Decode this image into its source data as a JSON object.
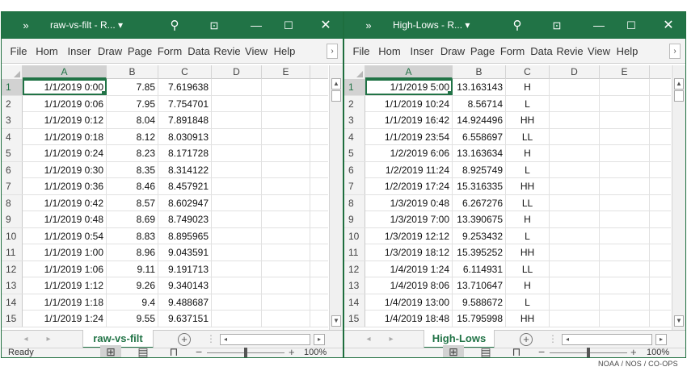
{
  "colors": {
    "excel_green": "#217346",
    "ribbon_bg": "#f3f3f3",
    "selected_header": "#d2d2d2"
  },
  "left": {
    "quick_access": "»",
    "title": "raw-vs-filt - R...",
    "title_arrow": "▾",
    "ribbon_tabs": [
      "File",
      "Hom",
      "Inser",
      "Draw",
      "Page",
      "Form",
      "Data",
      "Revie",
      "View",
      "Help"
    ],
    "columns": [
      "A",
      "B",
      "C",
      "D",
      "E"
    ],
    "rows": [
      {
        "n": "1",
        "a": "1/1/2019 0:00",
        "b": "7.85",
        "c": "7.619638"
      },
      {
        "n": "2",
        "a": "1/1/2019 0:06",
        "b": "7.95",
        "c": "7.754701"
      },
      {
        "n": "3",
        "a": "1/1/2019 0:12",
        "b": "8.04",
        "c": "7.891848"
      },
      {
        "n": "4",
        "a": "1/1/2019 0:18",
        "b": "8.12",
        "c": "8.030913"
      },
      {
        "n": "5",
        "a": "1/1/2019 0:24",
        "b": "8.23",
        "c": "8.171728"
      },
      {
        "n": "6",
        "a": "1/1/2019 0:30",
        "b": "8.35",
        "c": "8.314122"
      },
      {
        "n": "7",
        "a": "1/1/2019 0:36",
        "b": "8.46",
        "c": "8.457921"
      },
      {
        "n": "8",
        "a": "1/1/2019 0:42",
        "b": "8.57",
        "c": "8.602947"
      },
      {
        "n": "9",
        "a": "1/1/2019 0:48",
        "b": "8.69",
        "c": "8.749023"
      },
      {
        "n": "10",
        "a": "1/1/2019 0:54",
        "b": "8.83",
        "c": "8.895965"
      },
      {
        "n": "11",
        "a": "1/1/2019 1:00",
        "b": "8.96",
        "c": "9.043591"
      },
      {
        "n": "12",
        "a": "1/1/2019 1:06",
        "b": "9.11",
        "c": "9.191713"
      },
      {
        "n": "13",
        "a": "1/1/2019 1:12",
        "b": "9.26",
        "c": "9.340143"
      },
      {
        "n": "14",
        "a": "1/1/2019 1:18",
        "b": "9.4",
        "c": "9.488687"
      },
      {
        "n": "15",
        "a": "1/1/2019 1:24",
        "b": "9.55",
        "c": "9.637151"
      }
    ],
    "sheet_tab": "raw-vs-filt",
    "status": "Ready",
    "zoom": "100%"
  },
  "right": {
    "quick_access": "»",
    "title": "High-Lows - R...",
    "title_arrow": "▾",
    "ribbon_tabs": [
      "File",
      "Hom",
      "Inser",
      "Draw",
      "Page",
      "Form",
      "Data",
      "Revie",
      "View",
      "Help"
    ],
    "columns": [
      "A",
      "B",
      "C",
      "D",
      "E"
    ],
    "rows": [
      {
        "n": "1",
        "a": "1/1/2019 5:00",
        "b": "13.163143",
        "c": "H"
      },
      {
        "n": "2",
        "a": "1/1/2019 10:24",
        "b": "8.56714",
        "c": "L"
      },
      {
        "n": "3",
        "a": "1/1/2019 16:42",
        "b": "14.924496",
        "c": "HH"
      },
      {
        "n": "4",
        "a": "1/1/2019 23:54",
        "b": "6.558697",
        "c": "LL"
      },
      {
        "n": "5",
        "a": "1/2/2019 6:06",
        "b": "13.163634",
        "c": "H"
      },
      {
        "n": "6",
        "a": "1/2/2019 11:24",
        "b": "8.925749",
        "c": "L"
      },
      {
        "n": "7",
        "a": "1/2/2019 17:24",
        "b": "15.316335",
        "c": "HH"
      },
      {
        "n": "8",
        "a": "1/3/2019 0:48",
        "b": "6.267276",
        "c": "LL"
      },
      {
        "n": "9",
        "a": "1/3/2019 7:00",
        "b": "13.390675",
        "c": "H"
      },
      {
        "n": "10",
        "a": "1/3/2019 12:12",
        "b": "9.253432",
        "c": "L"
      },
      {
        "n": "11",
        "a": "1/3/2019 18:12",
        "b": "15.395252",
        "c": "HH"
      },
      {
        "n": "12",
        "a": "1/4/2019 1:24",
        "b": "6.114931",
        "c": "LL"
      },
      {
        "n": "13",
        "a": "1/4/2019 8:06",
        "b": "13.710647",
        "c": "H"
      },
      {
        "n": "14",
        "a": "1/4/2019 13:00",
        "b": "9.588672",
        "c": "L"
      },
      {
        "n": "15",
        "a": "1/4/2019 18:48",
        "b": "15.795998",
        "c": "HH"
      }
    ],
    "sheet_tab": "High-Lows",
    "status": "",
    "zoom": "100%"
  },
  "credit": "NOAA / NOS / CO-OPS"
}
